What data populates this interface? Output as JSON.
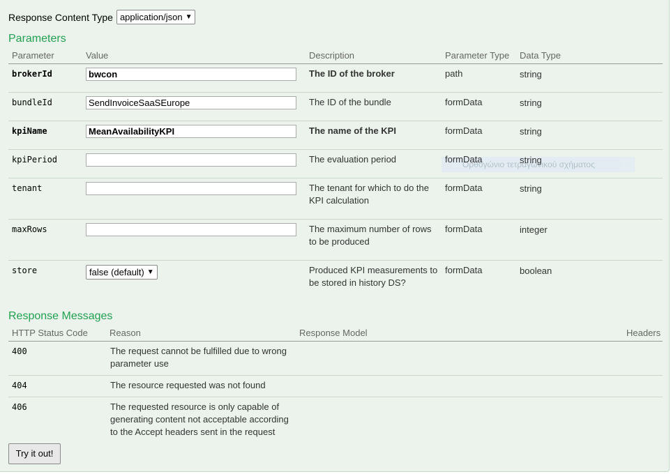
{
  "content_type": {
    "label": "Response Content Type",
    "value": "application/json"
  },
  "parameters": {
    "title": "Parameters",
    "headers": [
      "Parameter",
      "Value",
      "Description",
      "Parameter Type",
      "Data Type"
    ],
    "rows": [
      {
        "name": "brokerId",
        "value": "bwcon",
        "desc1": "The ID of the broker",
        "desc2": "",
        "ptype": "path",
        "dtype": "string"
      },
      {
        "name": "bundleId",
        "value": "SendInvoiceSaaSEurope",
        "desc1": "The ID of the bundle",
        "desc2": "",
        "ptype": "formData",
        "dtype": "string"
      },
      {
        "name": "kpiName",
        "value": "MeanAvailabilityKPI",
        "desc1": "The name of the KPI",
        "desc2": "",
        "ptype": "formData",
        "dtype": "string"
      },
      {
        "name": "kpiPeriod",
        "value": "",
        "desc1": "The evaluation period",
        "desc2": "",
        "ptype": "formData",
        "dtype": "string"
      },
      {
        "name": "tenant",
        "value": "",
        "desc1": "The tenant for which to do the",
        "desc2": "KPI calculation",
        "ptype": "formData",
        "dtype": "string"
      },
      {
        "name": "maxRows",
        "value": "",
        "desc1": "The maximum number of rows",
        "desc2": "to be produced",
        "ptype": "formData",
        "dtype": "integer"
      },
      {
        "name": "store",
        "value": "false (default)",
        "desc1": "Produced KPI measurements to",
        "desc2": "be stored in history DS?",
        "ptype": "formData",
        "dtype": "boolean"
      }
    ]
  },
  "ghost_tooltip": "Ορθογώνιο τετραγωνικού σχήματος",
  "responses": {
    "title": "Response Messages",
    "headers": [
      "HTTP Status Code",
      "Reason",
      "Response Model",
      "Headers"
    ],
    "rows": [
      {
        "code": "400",
        "r1": "The request cannot be fulfilled due to wrong",
        "r2": "parameter use",
        "r3": ""
      },
      {
        "code": "404",
        "r1": "The resource requested was not found",
        "r2": "",
        "r3": ""
      },
      {
        "code": "406",
        "r1": "The requested resource is only capable of",
        "r2": "generating content not acceptable according",
        "r3": "to the Accept headers sent in the request"
      }
    ]
  },
  "try_button": "Try it out!"
}
